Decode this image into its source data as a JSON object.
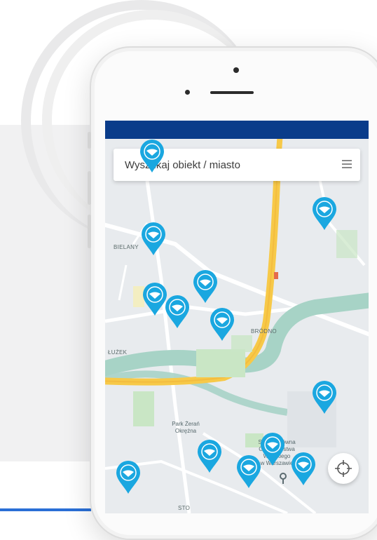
{
  "search": {
    "placeholder": "Wyszukaj obiekt / miasto"
  },
  "icons": {
    "menu": "hamburger-menu-icon",
    "locate": "crosshair-locate-icon",
    "pin": "map-pin-icon"
  },
  "colors": {
    "status_bar": "#0a3c8a",
    "pin": "#1aa7e0",
    "road_major": "#f7c948",
    "river": "#a7d3c6",
    "park": "#c9e6c5"
  },
  "map_labels": [
    {
      "id": "district-nw",
      "text": "BIELANY"
    },
    {
      "id": "district-ne",
      "text": "BRÓDNO"
    },
    {
      "id": "district-w",
      "text": "ŁUŻEK"
    },
    {
      "id": "district-s",
      "text": "STO"
    }
  ],
  "poi": {
    "park": "Park Żerań\nOkrężna",
    "school": "Szkoła Główna\nGospodarstwa\nWiejskiego\nw Warszawie"
  },
  "pins_count": 13
}
